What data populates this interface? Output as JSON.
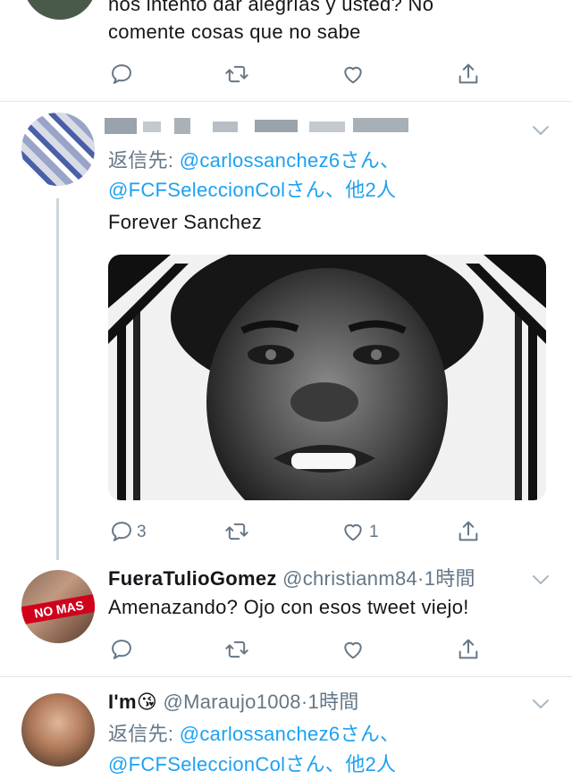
{
  "tweet_top": {
    "text_line1": "nos intentó dar alegrías y usted? No",
    "text_line2": "comente cosas que no sabe"
  },
  "tweet_reply1": {
    "reply_prefix": "返信先:",
    "reply_to_1": "@carlossanchez6さん、",
    "reply_to_2": "@FCFSeleccionColさん、他2人",
    "body": "Forever Sanchez",
    "reply_count": "3",
    "like_count": "1"
  },
  "tweet_reply2": {
    "display_name": "FueraTulioGomez",
    "handle": "@christianm84",
    "time": "1時間",
    "body": "Amenazando? Ojo con esos tweet viejo!",
    "avatar_text": "NO MAS"
  },
  "tweet_reply3": {
    "display_name": "I'm",
    "emoji": "😘",
    "handle": "@Maraujo1008",
    "time": "1時間",
    "reply_prefix": "返信先:",
    "reply_to_1": "@carlossanchez6さん、",
    "reply_to_2": "@FCFSeleccionColさん、他2人"
  },
  "colors": {
    "link": "#1da1f2",
    "muted": "#657786",
    "divider": "#e1e8ed"
  }
}
